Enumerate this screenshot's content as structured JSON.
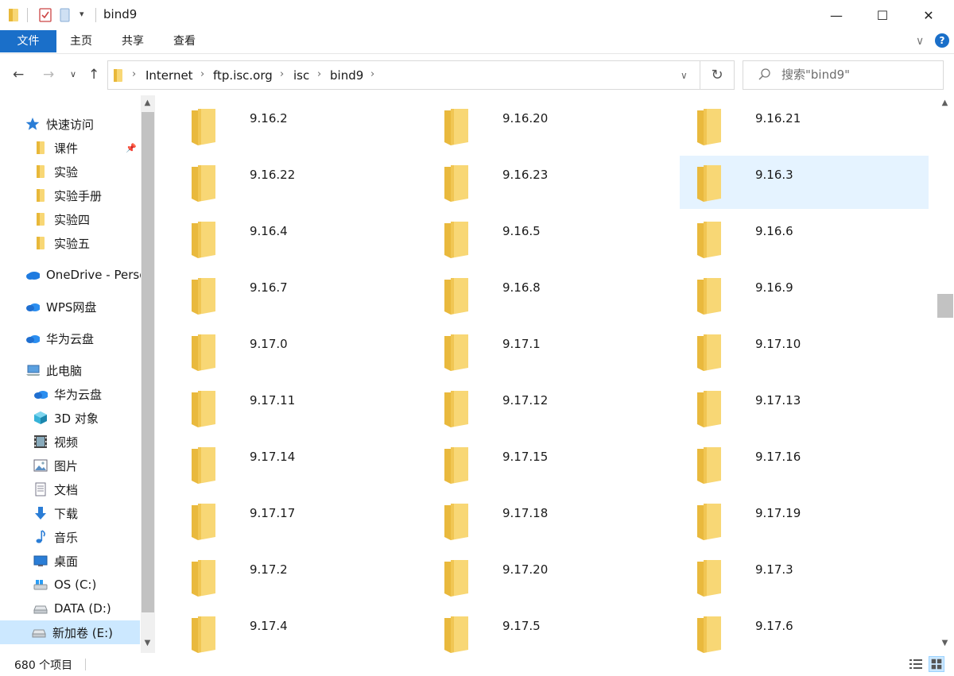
{
  "window": {
    "title": "bind9",
    "minimize": "—",
    "maximize": "☐",
    "close": "✕"
  },
  "ribbon": {
    "tabs": [
      "文件",
      "主页",
      "共享",
      "查看"
    ],
    "expand": "∨",
    "help": "?"
  },
  "nav": {
    "back": "←",
    "forward": "→",
    "recent": "∨",
    "up": "↑"
  },
  "address": {
    "crumbs": [
      "Internet",
      "ftp.isc.org",
      "isc",
      "bind9"
    ],
    "dropdown": "∨",
    "refresh": "↻"
  },
  "search": {
    "placeholder": "搜索\"bind9\""
  },
  "sidebar": {
    "quick_access": "快速访问",
    "pinned": [
      {
        "label": "课件",
        "pinned": true
      },
      {
        "label": "实验"
      },
      {
        "label": "实验手册"
      },
      {
        "label": "实验四"
      },
      {
        "label": "实验五"
      }
    ],
    "onedrive": "OneDrive - Perso",
    "wps": "WPS网盘",
    "huawei": "华为云盘",
    "this_pc": "此电脑",
    "pc_items": [
      {
        "label": "华为云盘",
        "icon": "cloud-icon"
      },
      {
        "label": "3D 对象",
        "icon": "cube-icon"
      },
      {
        "label": "视频",
        "icon": "film-icon"
      },
      {
        "label": "图片",
        "icon": "picture-icon"
      },
      {
        "label": "文档",
        "icon": "document-icon"
      },
      {
        "label": "下载",
        "icon": "download-icon"
      },
      {
        "label": "音乐",
        "icon": "music-icon"
      },
      {
        "label": "桌面",
        "icon": "desktop-icon"
      },
      {
        "label": "OS (C:)",
        "icon": "os-drive-icon"
      },
      {
        "label": "DATA (D:)",
        "icon": "drive-icon"
      },
      {
        "label": "新加卷 (E:)",
        "icon": "drive-icon",
        "selected": true
      }
    ]
  },
  "folders": [
    "9.16.2",
    "9.16.20",
    "9.16.21",
    "9.16.22",
    "9.16.23",
    "9.16.3",
    "9.16.4",
    "9.16.5",
    "9.16.6",
    "9.16.7",
    "9.16.8",
    "9.16.9",
    "9.17.0",
    "9.17.1",
    "9.17.10",
    "9.17.11",
    "9.17.12",
    "9.17.13",
    "9.17.14",
    "9.17.15",
    "9.17.16",
    "9.17.17",
    "9.17.18",
    "9.17.19",
    "9.17.2",
    "9.17.20",
    "9.17.3",
    "9.17.4",
    "9.17.5",
    "9.17.6"
  ],
  "selected_folder": "9.16.3",
  "status": {
    "item_count": "680 个项目"
  },
  "colors": {
    "accent": "#1a6fc9",
    "folder": "#f8d775",
    "selection": "#e5f3ff",
    "nav_selection": "#cce8ff"
  }
}
